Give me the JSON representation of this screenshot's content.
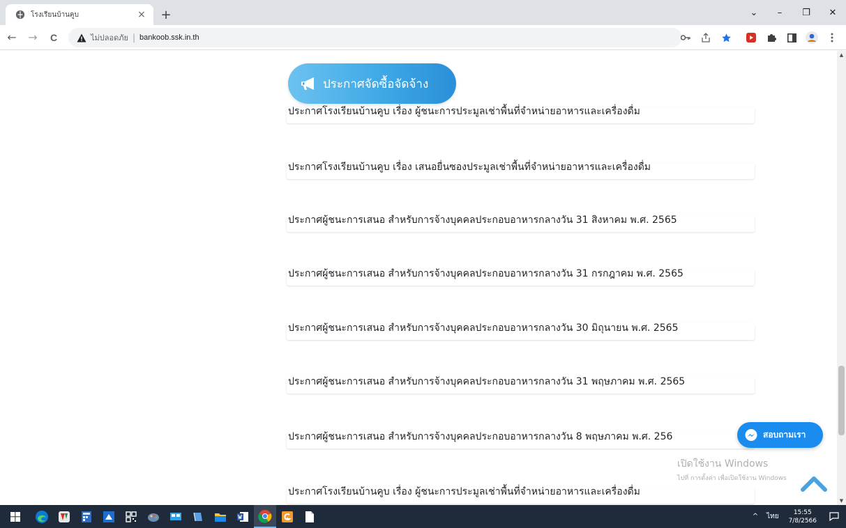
{
  "browser": {
    "tab_title": "โรงเรียนบ้านคูบ",
    "tab_close": "×",
    "new_tab": "+",
    "omnibox": {
      "security_text": "ไม่ปลอดภัย",
      "separator": "|",
      "url": "bankoob.ssk.in.th"
    },
    "window_controls": {
      "tab_search": "⌄",
      "minimize": "–",
      "maximize": "❐",
      "close": "✕"
    },
    "nav": {
      "back": "←",
      "forward": "→",
      "reload": "C"
    }
  },
  "page": {
    "section_button_label": "ประกาศจัดซื้อจัดจ้าง",
    "news_items": [
      {
        "title": "ประกาศโรงเรียนบ้านคูบ เรื่อง ผู้ชนะการประมูลเช่าพื้นที่จำหน่ายอาหารและเครื่องดื่ม"
      },
      {
        "title": "ประกาศโรงเรียนบ้านคูบ เรื่อง เสนอยื่นซองประมูลเช่าพื้นที่จำหน่ายอาหารและเครื่องดื่ม"
      },
      {
        "title": "ประกาศผู้ชนะการเสนอ สำหรับการจ้างบุคคลประกอบอาหารกลางวัน 31 สิงหาคม พ.ศ. 2565"
      },
      {
        "title": "ประกาศผู้ชนะการเสนอ สำหรับการจ้างบุคคลประกอบอาหารกลางวัน 31 กรกฎาคม พ.ศ. 2565"
      },
      {
        "title": "ประกาศผู้ชนะการเสนอ สำหรับการจ้างบุคคลประกอบอาหารกลางวัน 30 มิถุนายน พ.ศ. 2565"
      },
      {
        "title": "ประกาศผู้ชนะการเสนอ สำหรับการจ้างบุคคลประกอบอาหารกลางวัน 31 พฤษภาคม พ.ศ. 2565"
      },
      {
        "title": "ประกาศผู้ชนะการเสนอ สำหรับการจ้างบุคคลประกอบอาหารกลางวัน 8 พฤษภาคม พ.ศ. 256"
      },
      {
        "title": "ประกาศโรงเรียนบ้านคูบ เรื่อง ผู้ชนะการประมูลเช่าพื้นที่จำหน่ายอาหารและเครื่องดื่ม"
      }
    ],
    "chat_button_label": "สอบถามเรา",
    "watermark": {
      "line1": "เปิดใช้งาน Windows",
      "line2": "ไปที่ การตั้งค่า เพื่อเปิดใช้งาน Windows"
    },
    "colors": {
      "section_button": "#3fa9e6",
      "chat_button": "#1a8cf0",
      "news_text": "#212529"
    }
  },
  "taskbar": {
    "apps": [
      "start-icon",
      "edge-icon",
      "app-red-icon",
      "calculator-icon",
      "app-blue-icon",
      "qr-icon",
      "paint-icon",
      "network-icon",
      "book-icon",
      "file-explorer-icon",
      "word-icon",
      "chrome-icon",
      "app-orange-icon",
      "notepad-icon"
    ],
    "tray_chevron": "^",
    "language": "ไทย",
    "time": "15:55",
    "date": "7/8/2566"
  }
}
